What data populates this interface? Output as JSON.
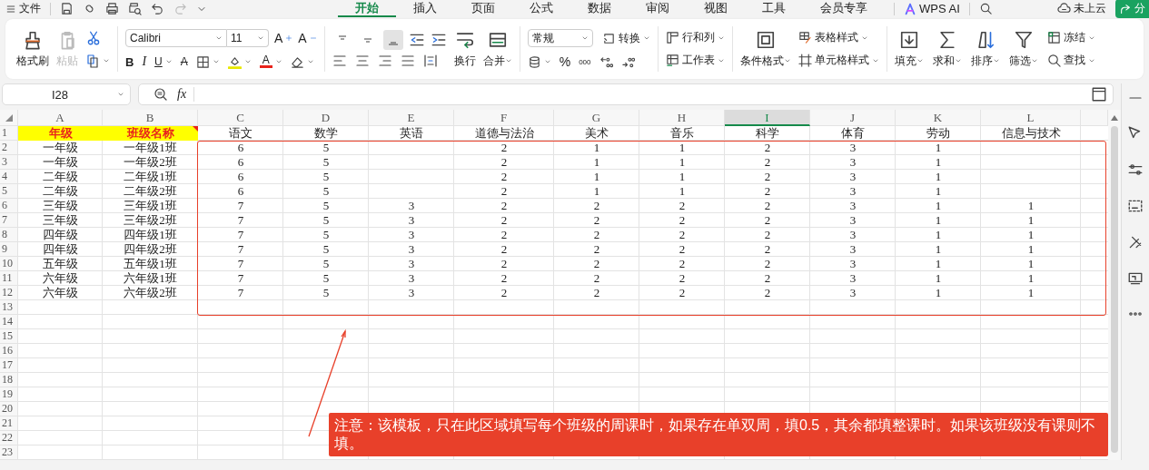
{
  "menu": {
    "file": "文件",
    "tabs": [
      {
        "label": "开始",
        "selected": true
      },
      {
        "label": "插入",
        "selected": false
      },
      {
        "label": "页面",
        "selected": false
      },
      {
        "label": "公式",
        "selected": false
      },
      {
        "label": "数据",
        "selected": false
      },
      {
        "label": "审阅",
        "selected": false
      },
      {
        "label": "视图",
        "selected": false
      },
      {
        "label": "工具",
        "selected": false
      },
      {
        "label": "会员专享",
        "selected": false
      }
    ],
    "ai": "WPS AI",
    "cloud": "未上云",
    "share": "分"
  },
  "ribbon": {
    "format_painter": "格式刷",
    "paste": {
      "label": "粘贴",
      "disabled": true
    },
    "font": "Calibri",
    "size": "11",
    "grow": "A",
    "shrink": "A",
    "bold": "B",
    "italic": "I",
    "underline": "U",
    "strike": "A",
    "font_color": "A",
    "vertical_align": [
      {
        "selected": false
      },
      {
        "selected": false
      },
      {
        "selected": true
      }
    ],
    "wrap": "换行",
    "merge": "合并",
    "number_format": "常规",
    "convert": "转换",
    "percent": "%",
    "thousands": "000",
    "rows_cols": "行和列",
    "sheet": "工作表",
    "conditional": "条件格式",
    "table_style": "表格样式",
    "cell_style": "单元格样式",
    "fill": "填充",
    "sum": "求和",
    "sort": "排序",
    "filter": "筛选",
    "freeze": "冻结",
    "find": "查找"
  },
  "formula_bar": {
    "cell_ref": "I28",
    "fx": "fx"
  },
  "sheet": {
    "columns": [
      {
        "label": "A",
        "selected": false
      },
      {
        "label": "B",
        "selected": false
      },
      {
        "label": "C",
        "selected": false
      },
      {
        "label": "D",
        "selected": false
      },
      {
        "label": "E",
        "selected": false
      },
      {
        "label": "F",
        "selected": false
      },
      {
        "label": "G",
        "selected": false
      },
      {
        "label": "H",
        "selected": false
      },
      {
        "label": "I",
        "selected": true
      },
      {
        "label": "J",
        "selected": false
      },
      {
        "label": "K",
        "selected": false
      },
      {
        "label": "L",
        "selected": false
      }
    ],
    "header_row": {
      "num": "1",
      "cells": [
        {
          "text": "年级",
          "highlight": true,
          "comment": false
        },
        {
          "text": "班级名称",
          "highlight": true,
          "comment": true
        },
        {
          "text": "语文",
          "highlight": false,
          "comment": false
        },
        {
          "text": "数学",
          "highlight": false,
          "comment": false
        },
        {
          "text": "英语",
          "highlight": false,
          "comment": false
        },
        {
          "text": "道德与法治",
          "highlight": false,
          "comment": false
        },
        {
          "text": "美术",
          "highlight": false,
          "comment": false
        },
        {
          "text": "音乐",
          "highlight": false,
          "comment": false
        },
        {
          "text": "科学",
          "highlight": false,
          "comment": false
        },
        {
          "text": "体育",
          "highlight": false,
          "comment": false
        },
        {
          "text": "劳动",
          "highlight": false,
          "comment": false
        },
        {
          "text": "信息与技术",
          "highlight": false,
          "comment": false
        }
      ]
    },
    "rows": [
      {
        "num": "2",
        "cells": [
          "一年级",
          "一年级1班",
          "6",
          "5",
          null,
          "2",
          "1",
          "1",
          "2",
          "3",
          "1",
          null
        ]
      },
      {
        "num": "3",
        "cells": [
          "一年级",
          "一年级2班",
          "6",
          "5",
          null,
          "2",
          "1",
          "1",
          "2",
          "3",
          "1",
          null
        ]
      },
      {
        "num": "4",
        "cells": [
          "二年级",
          "二年级1班",
          "6",
          "5",
          null,
          "2",
          "1",
          "1",
          "2",
          "3",
          "1",
          null
        ]
      },
      {
        "num": "5",
        "cells": [
          "二年级",
          "二年级2班",
          "6",
          "5",
          null,
          "2",
          "1",
          "1",
          "2",
          "3",
          "1",
          null
        ]
      },
      {
        "num": "6",
        "cells": [
          "三年级",
          "三年级1班",
          "7",
          "5",
          "3",
          "2",
          "2",
          "2",
          "2",
          "3",
          "1",
          "1"
        ]
      },
      {
        "num": "7",
        "cells": [
          "三年级",
          "三年级2班",
          "7",
          "5",
          "3",
          "2",
          "2",
          "2",
          "2",
          "3",
          "1",
          "1"
        ]
      },
      {
        "num": "8",
        "cells": [
          "四年级",
          "四年级1班",
          "7",
          "5",
          "3",
          "2",
          "2",
          "2",
          "2",
          "3",
          "1",
          "1"
        ]
      },
      {
        "num": "9",
        "cells": [
          "四年级",
          "四年级2班",
          "7",
          "5",
          "3",
          "2",
          "2",
          "2",
          "2",
          "3",
          "1",
          "1"
        ]
      },
      {
        "num": "10",
        "cells": [
          "五年级",
          "五年级1班",
          "7",
          "5",
          "3",
          "2",
          "2",
          "2",
          "2",
          "3",
          "1",
          "1"
        ]
      },
      {
        "num": "11",
        "cells": [
          "六年级",
          "六年级1班",
          "7",
          "5",
          "3",
          "2",
          "2",
          "2",
          "2",
          "3",
          "1",
          "1"
        ]
      },
      {
        "num": "12",
        "cells": [
          "六年级",
          "六年级2班",
          "7",
          "5",
          "3",
          "2",
          "2",
          "2",
          "2",
          "3",
          "1",
          "1"
        ]
      }
    ],
    "empty_rows": [
      "13",
      "14",
      "15",
      "16",
      "17",
      "18",
      "19",
      "20",
      "21",
      "22",
      "23"
    ],
    "note": "注意：该模板，只在此区域填写每个班级的周课时，如果存在单双周，填0.5，其余都填整课时。如果该班级没有课则不填。"
  }
}
